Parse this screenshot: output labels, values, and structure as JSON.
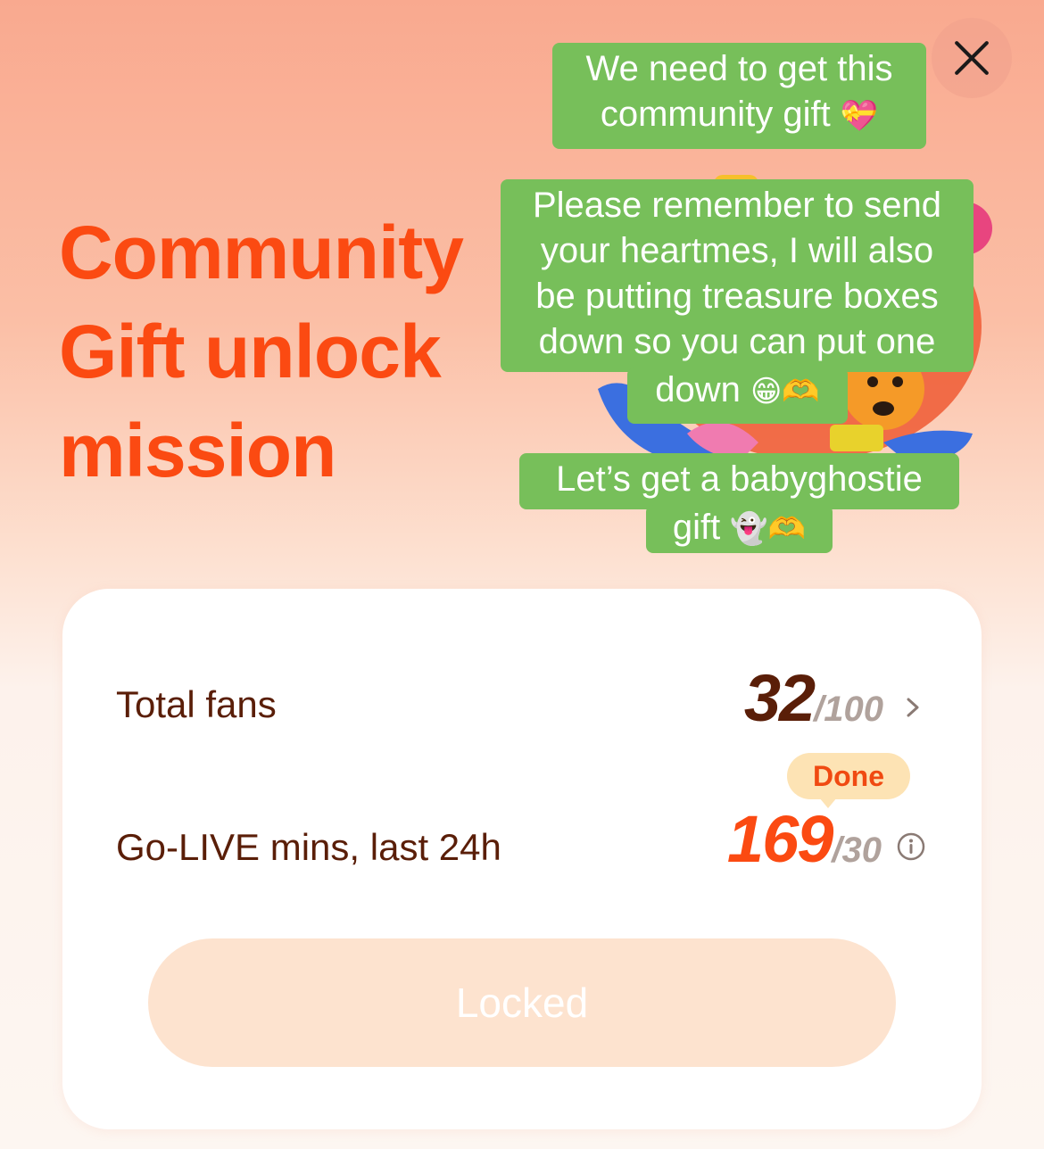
{
  "header": {
    "close_label": "×",
    "title_lines": [
      "Community",
      "Gift unlock",
      "mission"
    ]
  },
  "captions": [
    {
      "lines": [
        "We need to get this",
        "community gift"
      ],
      "emoji": "💝"
    },
    {
      "lines": [
        "Please remember to send",
        "your heartmes, I will also",
        "be putting treasure boxes",
        "down so you can put one",
        "down"
      ],
      "emoji": "😁🫶"
    },
    {
      "lines": [
        "Let’s get a babyghostie",
        "gift"
      ],
      "emoji": "👻🫶"
    }
  ],
  "mission": {
    "rows": [
      {
        "label": "Total fans",
        "value": "32",
        "target": "/100",
        "icon": "chevron-right-icon"
      },
      {
        "label": "Go-LIVE mins, last 24h",
        "value": "169",
        "target": "/30",
        "icon": "info-icon",
        "badge": "Done"
      }
    ],
    "button_label": "Locked"
  },
  "colors": {
    "accent": "#fb4a12",
    "caption_bg": "#77bf5a",
    "value_dark": "#5a1e08",
    "locked_bg": "#fde3cf"
  }
}
